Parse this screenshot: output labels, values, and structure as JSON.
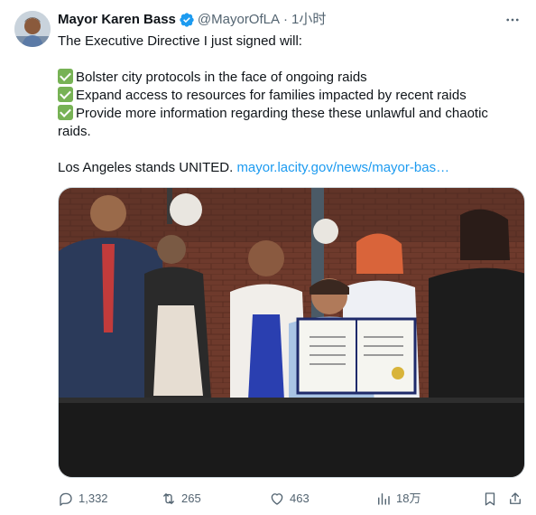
{
  "author": {
    "name": "Mayor Karen Bass",
    "handle": "@MayorOfLA",
    "separator": "·",
    "time": "1小时",
    "avatar_icon": "avatar-photo",
    "verified_icon": "verified-badge-icon",
    "accent_color": "#1d9bf0"
  },
  "tweet": {
    "intro": "The Executive Directive I just signed will:",
    "bullets": [
      "Bolster city protocols in the face of ongoing raids",
      "Expand access to resources for families impacted by recent raids",
      "Provide more information regarding these these unlawful and chaotic raids."
    ],
    "closing": "Los Angeles stands UNITED.",
    "link_text": "mayor.lacity.gov/news/mayor-bas…"
  },
  "actions": {
    "replies": "1,332",
    "retweets": "265",
    "likes": "463",
    "views": "18万"
  }
}
